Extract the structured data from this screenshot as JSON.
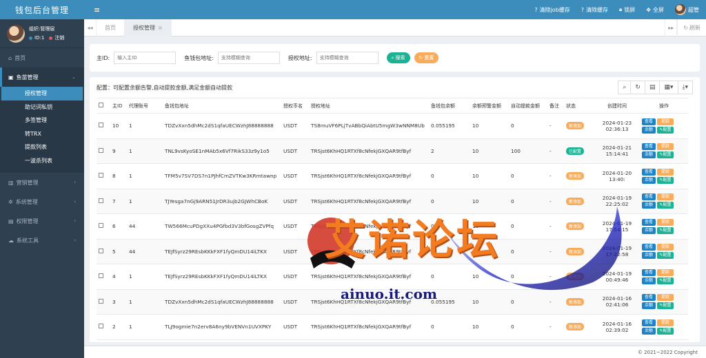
{
  "app": {
    "title": "钱包后台管理"
  },
  "user": {
    "name": "组织:管理层",
    "id_label": "ID:1",
    "logout": "注销"
  },
  "sidebar": {
    "items": [
      {
        "label": "首页",
        "icon": "home-icon"
      },
      {
        "label": "鱼苗管理",
        "icon": "fish-icon",
        "expanded": true,
        "children": [
          "授权管理",
          "助记词私钥",
          "多签管理",
          "转TRX",
          "提款列表",
          "一波杀列表"
        ]
      },
      {
        "label": "营销管理",
        "icon": "bank-icon"
      },
      {
        "label": "系统管理",
        "icon": "gear-icon"
      },
      {
        "label": "权限管理",
        "icon": "list-icon"
      },
      {
        "label": "系统工具",
        "icon": "cloud-icon"
      }
    ]
  },
  "topbar": {
    "clear_job": "清除job缓存",
    "clear_cache": "清除缓存",
    "lock": "锁屏",
    "fullscreen": "全屏",
    "admin": "超管"
  },
  "tabs": {
    "home": "首页",
    "auth": "授权管理",
    "refresh": "刷新"
  },
  "search": {
    "id_label": "主ID:",
    "id_placeholder": "输入主ID",
    "fish_label": "鱼钱包地址:",
    "fish_placeholder": "支持模糊查询",
    "auth_label": "授权地址:",
    "auth_placeholder": "支持模糊查询",
    "search_btn": "搜索",
    "reset_btn": "重置"
  },
  "config_note": "配置：可配置余额告警,自动提款金额,满足金额自动提款",
  "table": {
    "headers": [
      "主ID",
      "代理账号",
      "鱼钱包地址",
      "授权币名",
      "授权地址",
      "鱼钱包余额",
      "余额预警金额",
      "自动提款金额",
      "备注",
      "状态",
      "创建时间",
      "操作"
    ],
    "rows": [
      {
        "id": "10",
        "agent": "1",
        "addr": "TDZvXxn5dhMc2dS1qfaUECWzhJ88888888",
        "coin": "USDT",
        "auth": "TS8muVF6PLjTvABbQiAbtU5mgW3wNNM8Ub",
        "balance": "0.055195",
        "warn": "10",
        "auto": "0",
        "remark": "-",
        "status": "新添加",
        "status_type": "new",
        "date": "2024-01-23",
        "time": "02:36:13"
      },
      {
        "id": "9",
        "agent": "1",
        "addr": "TNL9vsKyoSE1nMAb5x6Vf7RikS33z9y1o5",
        "coin": "USDT",
        "auth": "TRSjst6KhHQ1RTXf8cNfekjGXQAR9tfByf",
        "balance": "2",
        "warn": "10",
        "auto": "100",
        "remark": "-",
        "status": "已配置",
        "status_type": "ok",
        "date": "2024-01-21",
        "time": "15:14:41"
      },
      {
        "id": "8",
        "agent": "1",
        "addr": "TFM5v7SV7DS7n1PJhfCmZVTKw3KRmtawnp",
        "coin": "USDT",
        "auth": "TRSjst6KhHQ1RTXf8cNfekjGXQAR9tfByf",
        "balance": "0",
        "warn": "10",
        "auto": "0",
        "remark": "-",
        "status": "新添加",
        "status_type": "new",
        "date": "2024-01-20",
        "time": "13:40:"
      },
      {
        "id": "7",
        "agent": "1",
        "addr": "TJYesga7nGj9ARN51JrDR3ujb2GJWhCBoK",
        "coin": "USDT",
        "auth": "TRSjst6KhHQ1RTXf8cNfekjGXQAR9tfByf",
        "balance": "0",
        "warn": "10",
        "auto": "0",
        "remark": "-",
        "status": "新添加",
        "status_type": "new",
        "date": "2024-01-19",
        "time": "22:25:02"
      },
      {
        "id": "6",
        "agent": "44",
        "addr": "TW566McuPDgXXu4PGfbd3V3bfGosgZVPfq",
        "coin": "USDT",
        "auth": "TRSjst6KhHQ1RTXf8cNfekjGXQAR9tfByf",
        "balance": "0",
        "warn": "10",
        "auto": "0",
        "remark": "-",
        "status": "新添加",
        "status_type": "new",
        "date": "2024-01-19",
        "time": "17:54:15"
      },
      {
        "id": "5",
        "agent": "44",
        "addr": "TEJfSyrz29REsbKKkFXF1fyQmDU14iLTKX",
        "coin": "USDT",
        "auth": "TRSjst6KhHQ1RTXf8cNfekjGXQAR9tfByf",
        "balance": "0",
        "warn": "10",
        "auto": "0",
        "remark": "-",
        "status": "新添加",
        "status_type": "new",
        "date": "2024-01-19",
        "time": "17:22:58"
      },
      {
        "id": "4",
        "agent": "1",
        "addr": "TEJfSyrz29REsbKKkFXF1fyQmDU14iLTKX",
        "coin": "USDT",
        "auth": "TRSjst6KhHQ1RTXf8cNfekjGXQAR9tfByf",
        "balance": "0",
        "warn": "10",
        "auto": "0",
        "remark": "-",
        "status": "新添加",
        "status_type": "new",
        "date": "2024-01-19",
        "time": "00:49:46"
      },
      {
        "id": "3",
        "agent": "1",
        "addr": "TDZvXxn5dhMc2dS1qfaUECWzhJ88888888",
        "coin": "USDT",
        "auth": "TRSjst6KhHQ1RTXf8cNfekjGXQAR9tfByf",
        "balance": "0.055195",
        "warn": "10",
        "auto": "0",
        "remark": "-",
        "status": "新添加",
        "status_type": "new",
        "date": "2024-01-16",
        "time": "02:41:06"
      },
      {
        "id": "2",
        "agent": "1",
        "addr": "TLJ9ogmie7n2erv8A6ny9bVENVn1UVXPKY",
        "coin": "USDT",
        "auth": "TRSjst6KhHQ1RTXf8cNfekjGXQAR9tfByf",
        "balance": "0",
        "warn": "10",
        "auto": "0",
        "remark": "-",
        "status": "新添加",
        "status_type": "new",
        "date": "2024-01-16",
        "time": "02:39:02"
      }
    ],
    "ops": {
      "view": "查看",
      "withdraw": "提款",
      "balance": "余额",
      "config": "配置"
    }
  },
  "footer": {
    "copyright": "© 2021~2022 Copyright"
  },
  "watermark": {
    "text": "艾诺论坛",
    "url": "ainuo.it.com"
  },
  "colors": {
    "primary": "#3c8dbc",
    "sidebar": "#2f4050",
    "green": "#1ab394",
    "orange": "#f8ac59",
    "blue": "#1c84c6"
  }
}
